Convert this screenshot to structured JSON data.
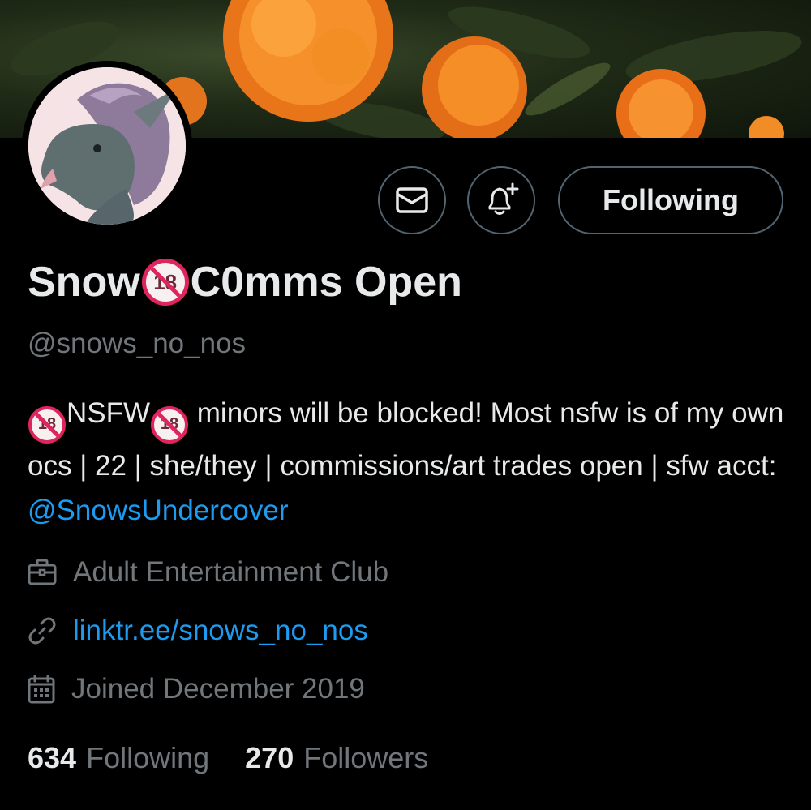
{
  "profile": {
    "name_part1": "Snow",
    "name_badge": "18",
    "name_part2": "C0mms Open",
    "handle": "@snows_no_nos",
    "bio": {
      "badge": "18",
      "nsfw": "NSFW",
      "text1": " minors will be blocked! Most nsfw is of my own ocs | 22 | she/they | commissions/art trades open | sfw acct: ",
      "mention": "@SnowsUndercover"
    },
    "category": "Adult Entertainment Club",
    "website": "linktr.ee/snows_no_nos",
    "joined": "Joined December 2019",
    "following_count": "634",
    "following_label": "Following",
    "followers_count": "270",
    "followers_label": "Followers"
  },
  "actions": {
    "message_icon": "envelope-icon",
    "notify_icon": "bell-plus-icon",
    "follow_label": "Following"
  },
  "colors": {
    "background": "#000000",
    "text": "#e7e9ea",
    "muted": "#71767b",
    "link": "#1d9bf0",
    "border": "#536471",
    "flower": "#f08a1e"
  }
}
